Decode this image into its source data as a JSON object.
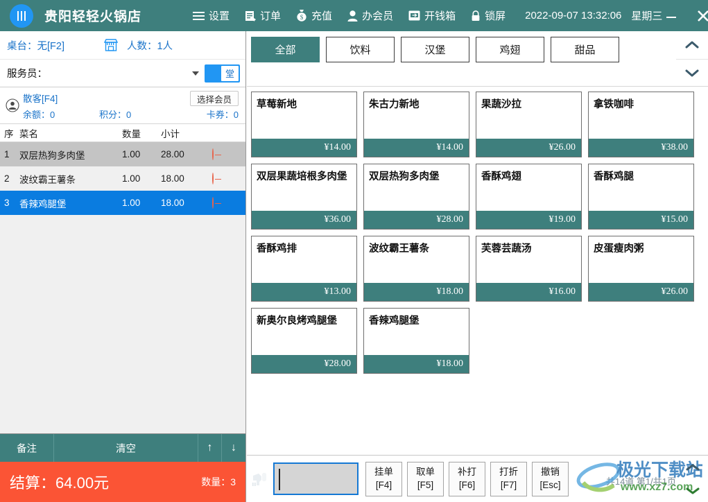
{
  "header": {
    "logo_icon": "restaurant-utensils-icon",
    "shop_name": "贵阳轻轻火锅店",
    "menu": [
      {
        "id": "settings",
        "icon": "hamburger-menu-icon",
        "label": "设置"
      },
      {
        "id": "orders",
        "icon": "order-list-icon",
        "label": "订单"
      },
      {
        "id": "recharge",
        "icon": "money-bag-icon",
        "label": "充值"
      },
      {
        "id": "member",
        "icon": "user-icon",
        "label": "办会员"
      },
      {
        "id": "cashbox",
        "icon": "cash-drawer-icon",
        "label": "开钱箱"
      },
      {
        "id": "lock",
        "icon": "lock-icon",
        "label": "锁屏"
      }
    ],
    "datetime": "2022-09-07 13:32:06",
    "weekday": "星期三",
    "minimize_label": "—",
    "close_label": "✕"
  },
  "left": {
    "table_label": "桌台：无[F2]",
    "shop_icon": "storefront-icon",
    "people_label": "人数：1人",
    "server_label": "服务员：",
    "server_value": "",
    "dropdown_icon": "chevron-down-icon",
    "mode_toggle_label": "堂",
    "member": {
      "avatar_icon": "user-avatar-icon",
      "name": "散客[F4]",
      "select_button": "选择会员",
      "balance": "余额：0",
      "points": "积分：0",
      "coupons": "卡券：0"
    },
    "order_table": {
      "columns": [
        "序",
        "菜名",
        "数量",
        "小计"
      ],
      "remove_icon": "minus-circle-icon",
      "rows": [
        {
          "seq": "1",
          "name": "双层热狗多肉堡",
          "qty": "1.00",
          "subtotal": "28.00",
          "state": "alt"
        },
        {
          "seq": "2",
          "name": "波纹霸王薯条",
          "qty": "1.00",
          "subtotal": "18.00",
          "state": "normal"
        },
        {
          "seq": "3",
          "name": "香辣鸡腿堡",
          "qty": "1.00",
          "subtotal": "18.00",
          "state": "sel"
        }
      ]
    },
    "actions": {
      "note": "备注",
      "clear": "清空",
      "up_icon": "arrow-up-icon",
      "up": "↑",
      "down_icon": "arrow-down-icon",
      "down": "↓"
    },
    "total": {
      "label": "结算：",
      "amount": "64.00元",
      "qty_label": "数量：3"
    }
  },
  "right": {
    "categories": [
      {
        "label": "全部",
        "active": true
      },
      {
        "label": "饮料",
        "active": false
      },
      {
        "label": "汉堡",
        "active": false
      },
      {
        "label": "鸡翅",
        "active": false
      },
      {
        "label": "甜品",
        "active": false
      }
    ],
    "cat_scroll_up_icon": "chevron-up-icon",
    "cat_scroll_down_icon": "chevron-down-icon",
    "products": [
      {
        "name": "草莓新地",
        "price": "¥14.00"
      },
      {
        "name": "朱古力新地",
        "price": "¥14.00"
      },
      {
        "name": "果蔬沙拉",
        "price": "¥26.00"
      },
      {
        "name": "拿铁咖啡",
        "price": "¥38.00"
      },
      {
        "name": "双层果蔬培根多肉堡",
        "price": "¥36.00"
      },
      {
        "name": "双层热狗多肉堡",
        "price": "¥28.00"
      },
      {
        "name": "香酥鸡翅",
        "price": "¥19.00"
      },
      {
        "name": "香酥鸡腿",
        "price": "¥15.00"
      },
      {
        "name": "香酥鸡排",
        "price": "¥13.00"
      },
      {
        "name": "波纹霸王薯条",
        "price": "¥18.00"
      },
      {
        "name": "芙蓉芸蔬汤",
        "price": "¥16.00"
      },
      {
        "name": "皮蛋瘦肉粥",
        "price": "¥26.00"
      },
      {
        "name": "新奥尔良烤鸡腿堡",
        "price": "¥28.00"
      },
      {
        "name": "香辣鸡腿堡",
        "price": "¥18.00"
      }
    ],
    "bottom": {
      "scanner_icon": "barcode-scanner-icon",
      "scan_value": "",
      "scan_placeholder": "",
      "function_buttons": [
        {
          "label": "挂单",
          "key": "[F4]"
        },
        {
          "label": "取单",
          "key": "[F5]"
        },
        {
          "label": "补打",
          "key": "[F6]"
        },
        {
          "label": "打折",
          "key": "[F7]"
        },
        {
          "label": "撤销",
          "key": "[Esc]"
        }
      ],
      "page_info": "共14道  第1/共1页",
      "scroll_up_icon": "chevron-up-icon",
      "scroll_down_icon": "chevron-down-icon"
    },
    "watermark": {
      "text": "极光下载站",
      "url": "www.xz7.com"
    }
  },
  "colors": {
    "teal": "#3E7F7D",
    "orange": "#FB5435",
    "blue": "#2196F3",
    "select_blue": "#0A7CE0",
    "link_blue": "#1A73C9",
    "remove_red": "#E8644B"
  }
}
